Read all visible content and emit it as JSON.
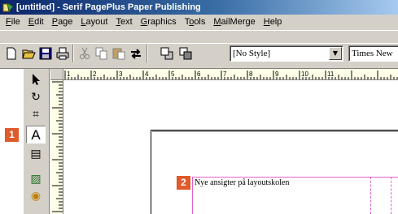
{
  "window": {
    "title": "[untitled] - Serif PagePlus Paper Publishing"
  },
  "menubar": {
    "items": [
      {
        "mnemonic": "F",
        "rest": "ile"
      },
      {
        "mnemonic": "E",
        "rest": "dit"
      },
      {
        "mnemonic": "P",
        "rest": "age"
      },
      {
        "mnemonic": "L",
        "rest": "ayout"
      },
      {
        "mnemonic": "T",
        "rest": "ext"
      },
      {
        "mnemonic": "G",
        "rest": "raphics"
      },
      {
        "mnemonic": "",
        "pre": "T",
        "mn": "o",
        "post": "ols"
      },
      {
        "mnemonic": "M",
        "rest": "ailMerge"
      },
      {
        "mnemonic": "H",
        "rest": "elp"
      }
    ]
  },
  "toolbar": {
    "style_value": "[No Style]",
    "font_value": "Times New",
    "dropdown_arrow": "▼",
    "icons": [
      "new-icon",
      "open-icon",
      "save-icon",
      "print-icon",
      "cut-icon",
      "copy-icon",
      "paste-icon",
      "undo-icon",
      "bring-front-icon",
      "send-back-icon"
    ]
  },
  "left_tools": {
    "icons": [
      "pointer-icon",
      "rotate-icon",
      "crop-icon",
      "text-icon",
      "frame-text-icon",
      "picture-icon",
      "shape-icon"
    ],
    "pointer": "▲",
    "rotate": "↻",
    "crop": "⌗",
    "text": "A",
    "frame": "▤",
    "picture": "▨",
    "shape": "◉"
  },
  "rulers": {
    "horizontal_labels": [
      "1",
      "2",
      "3",
      "4",
      "5",
      "6",
      "7",
      "8",
      "9",
      "10",
      "11"
    ]
  },
  "document": {
    "text": "Nye ansigter på layoutskolen"
  },
  "callouts": {
    "one": "1",
    "two": "2"
  },
  "colors": {
    "title_start": "#0a246a",
    "title_end": "#a6caf0",
    "chrome": "#d4d0c8",
    "ruler": "#ffffe8",
    "guide": "#e060d0",
    "callout": "#e05a2a"
  }
}
